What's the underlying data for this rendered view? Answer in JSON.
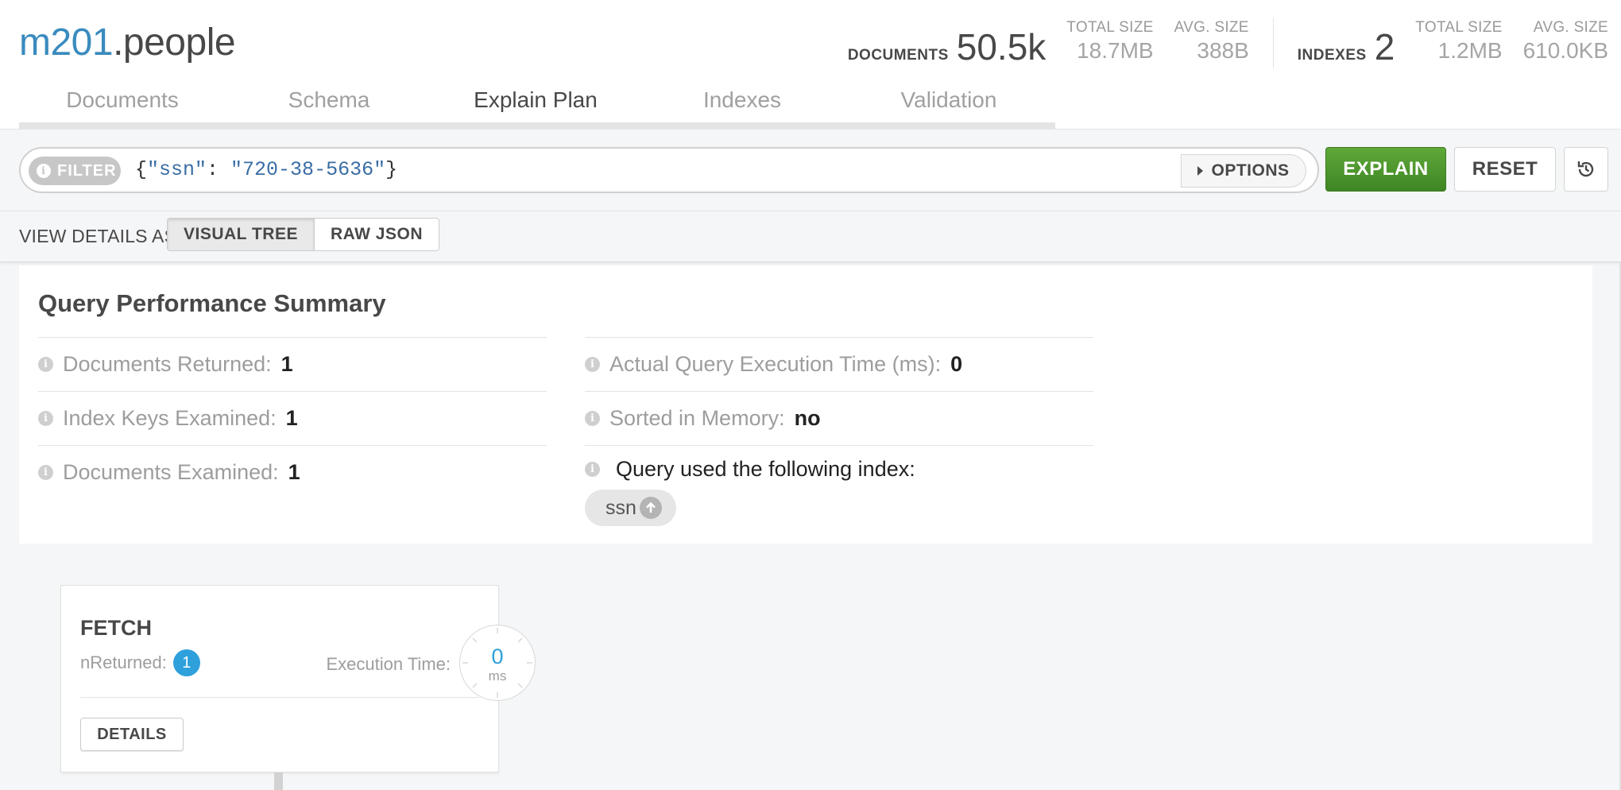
{
  "collection": {
    "db": "m201",
    "name": ".people"
  },
  "stats": {
    "documents": {
      "label": "DOCUMENTS",
      "value": "50.5k",
      "total_size_label": "TOTAL SIZE",
      "total_size": "18.7MB",
      "avg_size_label": "AVG. SIZE",
      "avg_size": "388B"
    },
    "indexes": {
      "label": "INDEXES",
      "value": "2",
      "total_size_label": "TOTAL SIZE",
      "total_size": "1.2MB",
      "avg_size_label": "AVG. SIZE",
      "avg_size": "610.0KB"
    }
  },
  "tabs": [
    {
      "label": "Documents",
      "active": false
    },
    {
      "label": "Schema",
      "active": false
    },
    {
      "label": "Explain Plan",
      "active": true
    },
    {
      "label": "Indexes",
      "active": false
    },
    {
      "label": "Validation",
      "active": false
    }
  ],
  "filter": {
    "pill_label": "FILTER",
    "query_open": "{",
    "query_key": "\"ssn\"",
    "query_colon": ": ",
    "query_value": "\"720-38-5636\"",
    "query_close": "}",
    "options_label": "OPTIONS"
  },
  "actions": {
    "explain_label": "EXPLAIN",
    "reset_label": "RESET",
    "history_icon": "history-icon"
  },
  "view": {
    "label": "VIEW DETAILS AS",
    "visual_tree": "VISUAL TREE",
    "raw_json": "RAW JSON",
    "selected": "VISUAL TREE"
  },
  "summary": {
    "title": "Query Performance Summary",
    "documents_returned": {
      "label": "Documents Returned:",
      "value": "1"
    },
    "index_keys_examined": {
      "label": "Index Keys Examined:",
      "value": "1"
    },
    "documents_examined": {
      "label": "Documents Examined:",
      "value": "1"
    },
    "execution_time": {
      "label": "Actual Query Execution Time (ms):",
      "value": "0"
    },
    "sorted_in_memory": {
      "label": "Sorted in Memory:",
      "value": "no"
    },
    "index_used": {
      "label": "Query used the following index:",
      "index_name": "ssn"
    }
  },
  "stage": {
    "name": "FETCH",
    "nreturned_label": "nReturned:",
    "nreturned": "1",
    "exec_time_label": "Execution Time:",
    "exec_time": "0",
    "exec_unit": "ms",
    "details_label": "DETAILS"
  },
  "colors": {
    "accent_green": "#5cb85c",
    "explain_green": "#4c9a2a",
    "db_blue": "#3a8bbf",
    "badge_blue": "#2ea0dc"
  }
}
